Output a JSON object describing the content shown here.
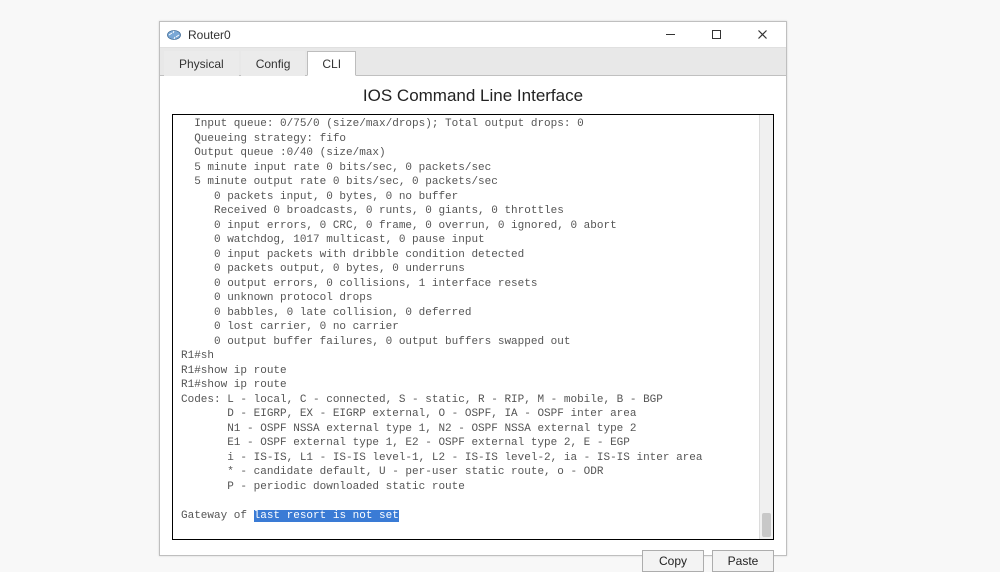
{
  "window": {
    "title": "Router0"
  },
  "tabs": {
    "physical": "Physical",
    "config": "Config",
    "cli": "CLI"
  },
  "cli": {
    "heading": "IOS Command Line Interface",
    "output_lines": [
      "  Input queue: 0/75/0 (size/max/drops); Total output drops: 0",
      "  Queueing strategy: fifo",
      "  Output queue :0/40 (size/max)",
      "  5 minute input rate 0 bits/sec, 0 packets/sec",
      "  5 minute output rate 0 bits/sec, 0 packets/sec",
      "     0 packets input, 0 bytes, 0 no buffer",
      "     Received 0 broadcasts, 0 runts, 0 giants, 0 throttles",
      "     0 input errors, 0 CRC, 0 frame, 0 overrun, 0 ignored, 0 abort",
      "     0 watchdog, 1017 multicast, 0 pause input",
      "     0 input packets with dribble condition detected",
      "     0 packets output, 0 bytes, 0 underruns",
      "     0 output errors, 0 collisions, 1 interface resets",
      "     0 unknown protocol drops",
      "     0 babbles, 0 late collision, 0 deferred",
      "     0 lost carrier, 0 no carrier",
      "     0 output buffer failures, 0 output buffers swapped out",
      "R1#sh",
      "R1#show ip route",
      "R1#show ip route",
      "Codes: L - local, C - connected, S - static, R - RIP, M - mobile, B - BGP",
      "       D - EIGRP, EX - EIGRP external, O - OSPF, IA - OSPF inter area",
      "       N1 - OSPF NSSA external type 1, N2 - OSPF NSSA external type 2",
      "       E1 - OSPF external type 1, E2 - OSPF external type 2, E - EGP",
      "       i - IS-IS, L1 - IS-IS level-1, L2 - IS-IS level-2, ia - IS-IS inter area",
      "       * - candidate default, U - per-user static route, o - ODR",
      "       P - periodic downloaded static route",
      ""
    ],
    "gateway_prefix": "Gateway of ",
    "gateway_selected": "last resort is not set",
    "prompt": "R1#"
  },
  "buttons": {
    "copy": "Copy",
    "paste": "Paste"
  }
}
